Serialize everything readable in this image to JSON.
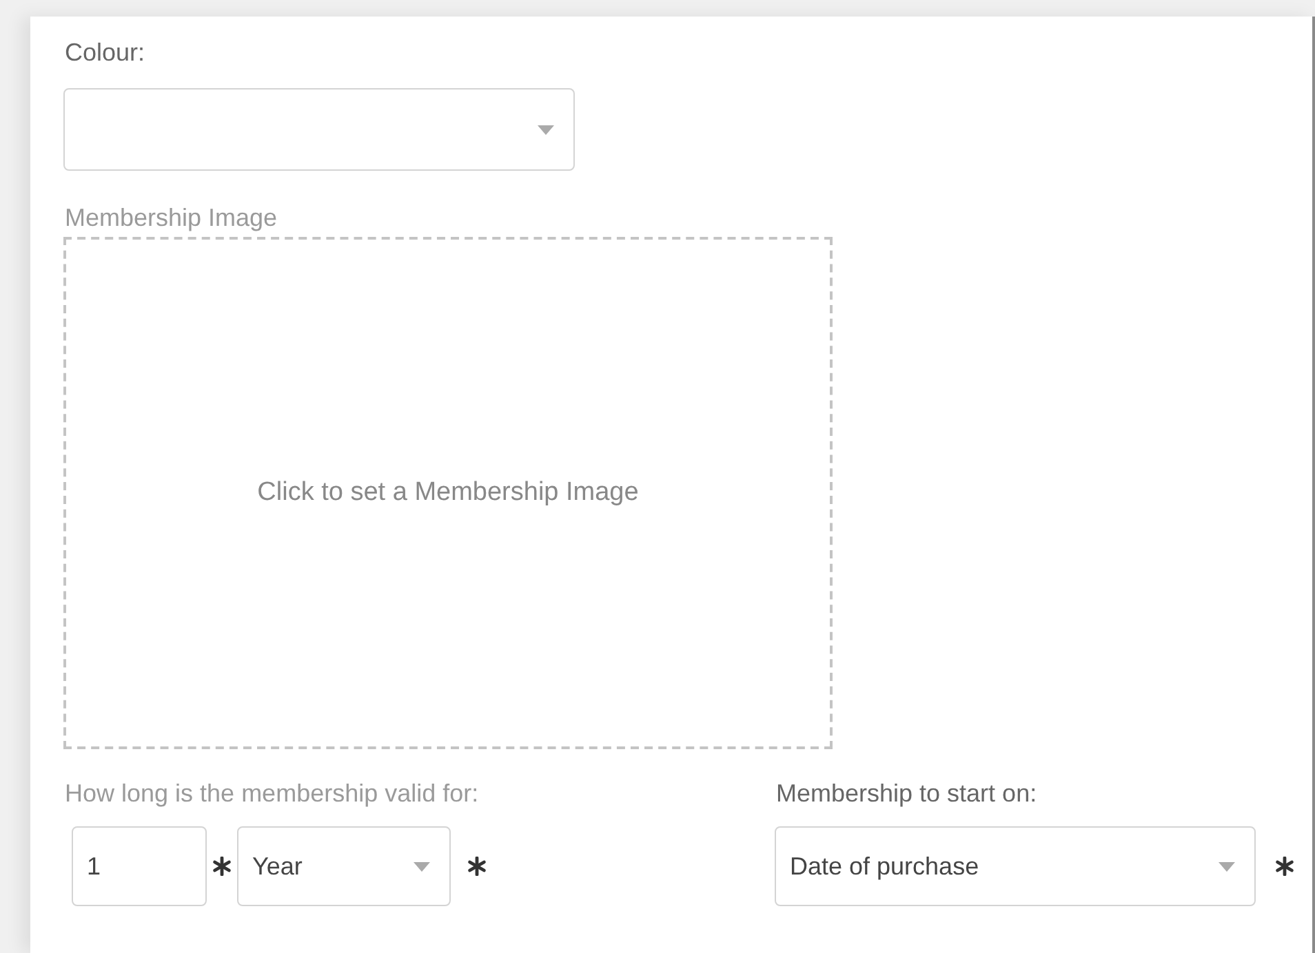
{
  "colour": {
    "label": "Colour:"
  },
  "membership_image": {
    "label": "Membership Image",
    "prompt": "Click to set a Membership Image"
  },
  "validity": {
    "label": "How long is the membership valid for:",
    "amount": {
      "value": "1",
      "required": true
    },
    "unit": {
      "value": "Year",
      "required": true
    }
  },
  "start": {
    "label": "Membership to start on:",
    "value": "Date of purchase",
    "required": true
  }
}
